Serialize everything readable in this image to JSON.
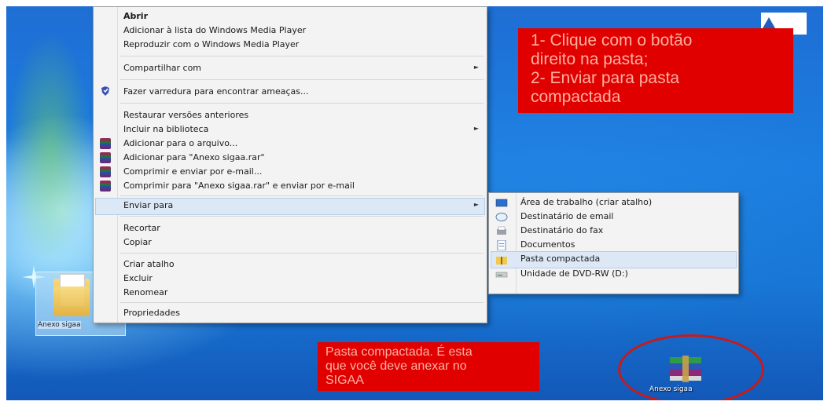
{
  "context_menu": {
    "items": [
      {
        "label": "Abrir",
        "bold": true
      },
      {
        "label": "Adicionar à lista do Windows Media Player"
      },
      {
        "label": "Reproduzir com o Windows Media Player"
      },
      {
        "label": "Compartilhar com",
        "submenu": true
      },
      {
        "label": "Fazer varredura para encontrar ameaças...",
        "icon": "shield-icon"
      },
      {
        "label": "Restaurar versões anteriores"
      },
      {
        "label": "Incluir na biblioteca",
        "submenu": true
      },
      {
        "label": "Adicionar para o arquivo...",
        "icon": "winrar-icon"
      },
      {
        "label": "Adicionar para \"Anexo sigaa.rar\"",
        "icon": "winrar-icon"
      },
      {
        "label": "Comprimir e enviar por e-mail...",
        "icon": "winrar-icon"
      },
      {
        "label": "Comprimir para \"Anexo sigaa.rar\" e enviar por e-mail",
        "icon": "winrar-icon"
      },
      {
        "label": "Enviar para",
        "submenu": true,
        "highlighted": true
      },
      {
        "label": "Recortar"
      },
      {
        "label": "Copiar"
      },
      {
        "label": "Criar atalho"
      },
      {
        "label": "Excluir"
      },
      {
        "label": "Renomear"
      },
      {
        "label": "Propriedades"
      }
    ],
    "arrow": "►"
  },
  "submenu": {
    "items": [
      {
        "label": "Área de trabalho (criar atalho)",
        "icon": "desktop-icon"
      },
      {
        "label": "Destinatário de email",
        "icon": "email-icon"
      },
      {
        "label": "Destinatário do fax",
        "icon": "fax-icon"
      },
      {
        "label": "Documentos",
        "icon": "documents-icon"
      },
      {
        "label": "Pasta compactada",
        "icon": "zip-folder-icon",
        "highlighted": true
      },
      {
        "label": "Unidade de DVD-RW (D:)",
        "icon": "dvd-drive-icon"
      }
    ]
  },
  "callouts": {
    "top": [
      "1- Clique com o botão",
      "direito na pasta;",
      "2- Enviar para pasta",
      "compactada"
    ],
    "bottom": [
      "Pasta compactada. É esta",
      "que você deve anexar no",
      "SIGAA"
    ]
  },
  "desktop": {
    "folder_label": "Anexo sigaa",
    "rar_label": "Anexo sigaa"
  },
  "colors": {
    "callout_bg": "#e00000",
    "callout_text": "#ffb0a0",
    "circle": "#c81a1a",
    "desktop_blue": "#1f6ed4",
    "menu_bg": "#f3f3f3",
    "highlight": "#dde8f6"
  }
}
